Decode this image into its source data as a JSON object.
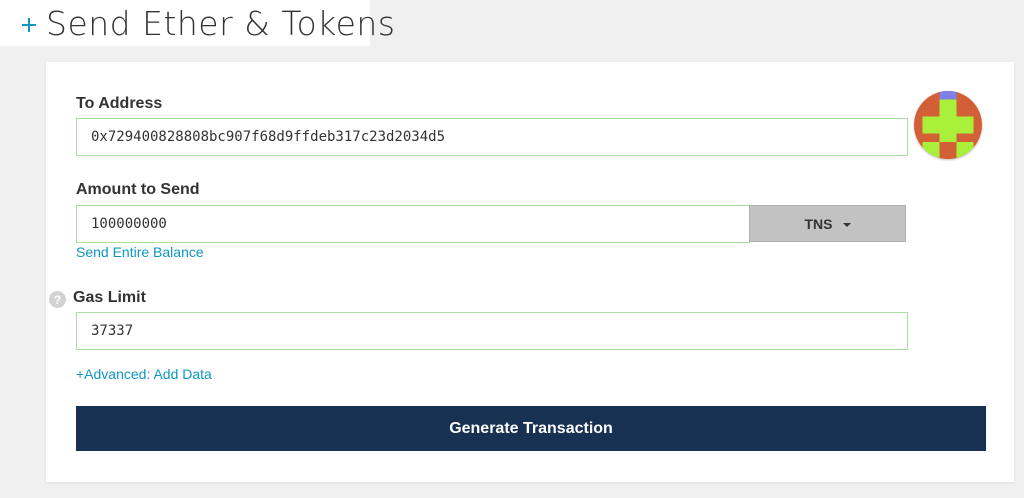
{
  "header": {
    "title": "Send Ether & Tokens",
    "expand_icon": "plus-icon"
  },
  "form": {
    "to_address": {
      "label": "To Address",
      "value": "0x729400828808bc907f68d9ffdeb317c23d2034d5",
      "identicon": "address-identicon"
    },
    "amount": {
      "label": "Amount to Send",
      "value": "100000000",
      "currency": "TNS",
      "send_entire_balance": "Send Entire Balance"
    },
    "gas_limit": {
      "label": "Gas Limit",
      "help_icon": "?",
      "value": "37337"
    },
    "advanced_link": "+Advanced: Add Data",
    "generate_button": "Generate Transaction"
  },
  "colors": {
    "accent": "#0e97c0",
    "button": "#163151",
    "field_border": "#a8e0a0",
    "identicon_primary": "#d35f37",
    "identicon_secondary": "#a8f03a",
    "identicon_tertiary": "#7f7fe8"
  }
}
